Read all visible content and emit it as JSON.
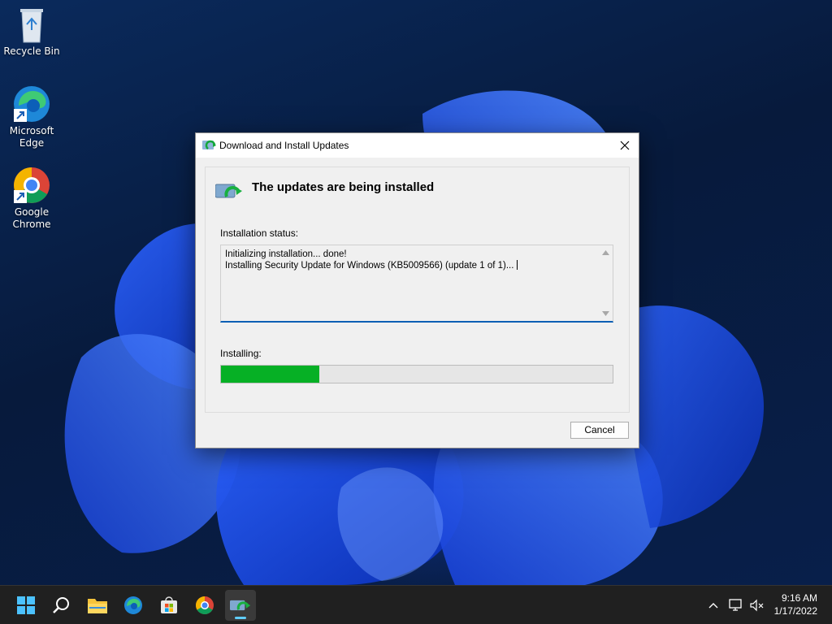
{
  "desktop": {
    "icons": [
      {
        "label": "Recycle Bin"
      },
      {
        "label": "Microsoft Edge"
      },
      {
        "label": "Google Chrome"
      }
    ]
  },
  "dialog": {
    "title": "Download and Install Updates",
    "heading": "The updates are being installed",
    "status_label": "Installation status:",
    "status_lines": [
      "Initializing installation... done!",
      "Installing Security Update for Windows (KB5009566) (update 1 of 1)..."
    ],
    "progress_label": "Installing:",
    "progress_fraction": 0.25,
    "cancel_label": "Cancel"
  },
  "taskbar": {
    "apps": [
      {
        "icon": "windows-start-icon"
      },
      {
        "icon": "search-icon"
      },
      {
        "icon": "file-explorer-icon"
      },
      {
        "icon": "edge-icon"
      },
      {
        "icon": "store-icon"
      },
      {
        "icon": "chrome-icon"
      },
      {
        "icon": "windows-update-icon",
        "active": true
      }
    ],
    "clock": {
      "time": "9:16 AM",
      "date": "1/17/2022"
    }
  },
  "colors": {
    "progress": "#06b025",
    "accent": "#0a5fb4",
    "taskbar": "#202020"
  }
}
